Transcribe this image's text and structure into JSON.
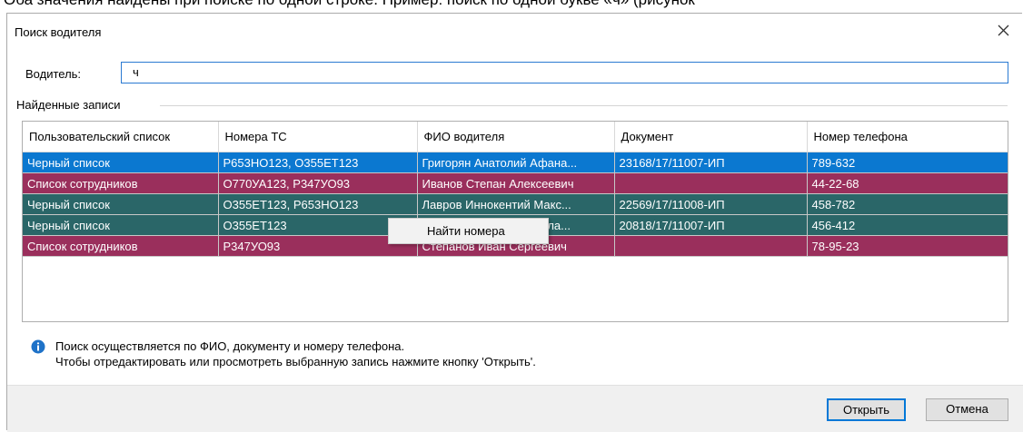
{
  "cropped_top_text": "Оба значения найдены при поиске по одной строке. Пример: поиск по одной букве «ч» (рисунок",
  "dialog": {
    "title": "Поиск водителя",
    "driver_label": "Водитель:",
    "driver_value": "ч",
    "group_label": "Найденные записи",
    "columns": [
      "Пользовательский список",
      "Номера ТС",
      "ФИО водителя",
      "Документ",
      "Номер телефона"
    ],
    "rows": [
      {
        "list": "Черный список",
        "plates": "Р653НО123, О355ЕТ123",
        "name": "Григорян Анатолий Афана...",
        "doc": "23168/17/11007-ИП",
        "phone": "789-632",
        "kind": "selected"
      },
      {
        "list": "Список сотрудников",
        "plates": "О770УА123, Р347УО93",
        "name": "Иванов Степан Алексеевич",
        "doc": "",
        "phone": "44-22-68",
        "kind": "staff"
      },
      {
        "list": "Черный список",
        "plates": "О355ЕТ123, Р653НО123",
        "name": "Лавров Иннокентий Макс...",
        "doc": "22569/17/11008-ИП",
        "phone": "458-782",
        "kind": "black"
      },
      {
        "list": "Черный список",
        "plates": "О355ЕТ123",
        "name": "Николаев Сергей Никола...",
        "doc": "20818/17/11007-ИП",
        "phone": "456-412",
        "kind": "black"
      },
      {
        "list": "Список сотрудников",
        "plates": "Р347УО93",
        "name": "Степанов Иван Сергеевич",
        "doc": "",
        "phone": "78-95-23",
        "kind": "staff"
      }
    ],
    "context_menu": {
      "item": "Найти номера"
    },
    "info_line1": "Поиск осуществляется по ФИО, документу и номеру телефона.",
    "info_line2": "Чтобы отредактировать или просмотреть выбранную запись нажмите кнопку 'Открыть'.",
    "open_button": "Открыть",
    "cancel_button": "Отмена"
  },
  "colors": {
    "selected_row": "#0b78d0",
    "staff_row": "#9a2f5c",
    "blacklist_row": "#2a6668",
    "info_icon": "#1e72c8"
  },
  "icons": {
    "close": "close-icon",
    "info": "info-icon"
  }
}
